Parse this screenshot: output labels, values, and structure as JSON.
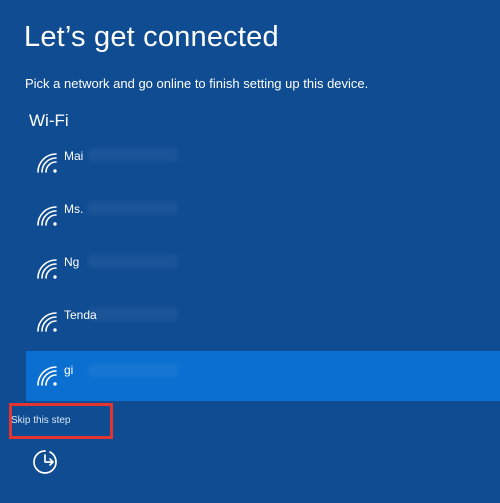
{
  "page": {
    "title": "Let’s get connected",
    "subtitle": "Pick a network and go online to finish setting up this device."
  },
  "wifi": {
    "section_label": "Wi-Fi",
    "networks": [
      {
        "name": "Mai",
        "selected": false
      },
      {
        "name": "Ms.",
        "selected": false
      },
      {
        "name": "Ng",
        "selected": false
      },
      {
        "name": "Tenda",
        "selected": false
      },
      {
        "name": "gi",
        "selected": true
      }
    ]
  },
  "actions": {
    "skip_label": "Skip this step"
  },
  "icons": {
    "wifi": "wifi-icon",
    "accessibility": "ease-of-access-icon"
  },
  "colors": {
    "background": "#0f4c92",
    "selected": "#0a6fd0",
    "highlight_box": "#e3342f"
  }
}
